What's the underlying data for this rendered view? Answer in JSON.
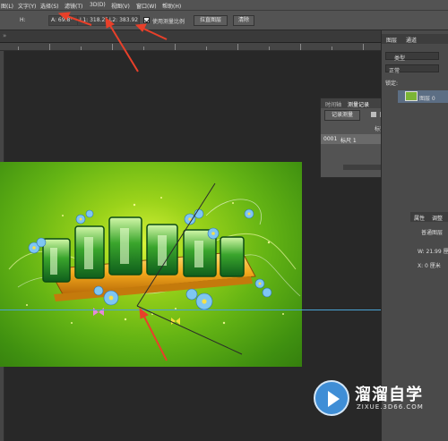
{
  "menu": [
    {
      "key": "m1",
      "label": "图(L)"
    },
    {
      "key": "m2",
      "label": "文字(Y)"
    },
    {
      "key": "m3",
      "label": "选择(S)"
    },
    {
      "key": "m4",
      "label": "滤镜(T)"
    },
    {
      "key": "m5",
      "label": "3D(D)"
    },
    {
      "key": "m6",
      "label": "视图(V)"
    },
    {
      "key": "m7",
      "label": "窗口(W)"
    },
    {
      "key": "m8",
      "label": "帮助(H)"
    }
  ],
  "options": {
    "h_label": "H:",
    "angle_label": "A: 69.8°",
    "l1_label": "L1: 318.25",
    "l2_label": "L2: 383.92",
    "scale_label": "使用测量比例",
    "straighten_button": "拉直图层",
    "clear_button": "清除",
    "scale_checked": true
  },
  "history_panel": {
    "tabs": [
      "时间轴",
      "测量记录"
    ],
    "record_button": "记录测量",
    "header": "标签",
    "rows": [
      {
        "id": "0001",
        "label": "标尺 1",
        "value": "201"
      }
    ]
  },
  "layers_panel": {
    "tabs": [
      "图层",
      "通道"
    ],
    "kind_label": "类型",
    "blend_mode": "正常",
    "lock_label": "锁定:",
    "layer_name": "图层 0"
  },
  "properties_panel": {
    "tabs": [
      "属性",
      "调整"
    ],
    "doc_label": "普通图层",
    "w_label": "W: 21.99 厘米",
    "x_label": "X: 0 厘米"
  },
  "watermark": {
    "title": "溜溜自学",
    "url": "ZIXUE.3D66.COM"
  },
  "colors": {
    "arrow": "#e8402a",
    "guide": "#4aa3d6",
    "canvas_green": "#64b414",
    "brand_blue": "#3f8ed6"
  }
}
